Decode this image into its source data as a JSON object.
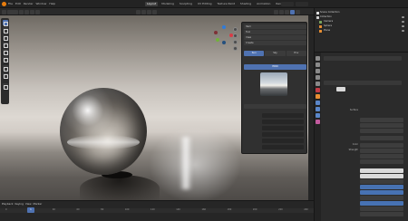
{
  "app": {
    "menu": [
      "File",
      "Edit",
      "Render",
      "Window",
      "Help"
    ],
    "workspace_tabs": [
      "Layout",
      "Modeling",
      "Sculpting",
      "UV Editing",
      "Texture Paint",
      "Shading",
      "Animation",
      "Rendering"
    ],
    "active_tab": "Layout"
  },
  "npanel": {
    "rows": [
      "Item",
      "Tool",
      "View",
      "Create"
    ],
    "tabs": [
      "Sun",
      "Sky",
      "Env"
    ],
    "hdri_label": "HDRI",
    "params": [
      "",
      "",
      "",
      "",
      "",
      ""
    ]
  },
  "outliner": {
    "items": [
      "Scene Collection",
      "Collection",
      "Camera",
      "Sphere",
      "Plane"
    ]
  },
  "properties": {
    "section": "World",
    "labels": [
      "Surface",
      "",
      "Color",
      "Strength",
      "",
      "",
      "",
      "",
      "Volume",
      "",
      "",
      "",
      ""
    ]
  },
  "timeline": {
    "controls": [
      "Playback",
      "Keying",
      "View",
      "Marker"
    ],
    "frame": "1",
    "ticks": [
      "0",
      "20",
      "40",
      "60",
      "80",
      "100",
      "120",
      "140",
      "160",
      "180",
      "200",
      "220",
      "240"
    ]
  },
  "colors": {
    "accent": "#4f72b1",
    "brand": "#e87d0d"
  }
}
